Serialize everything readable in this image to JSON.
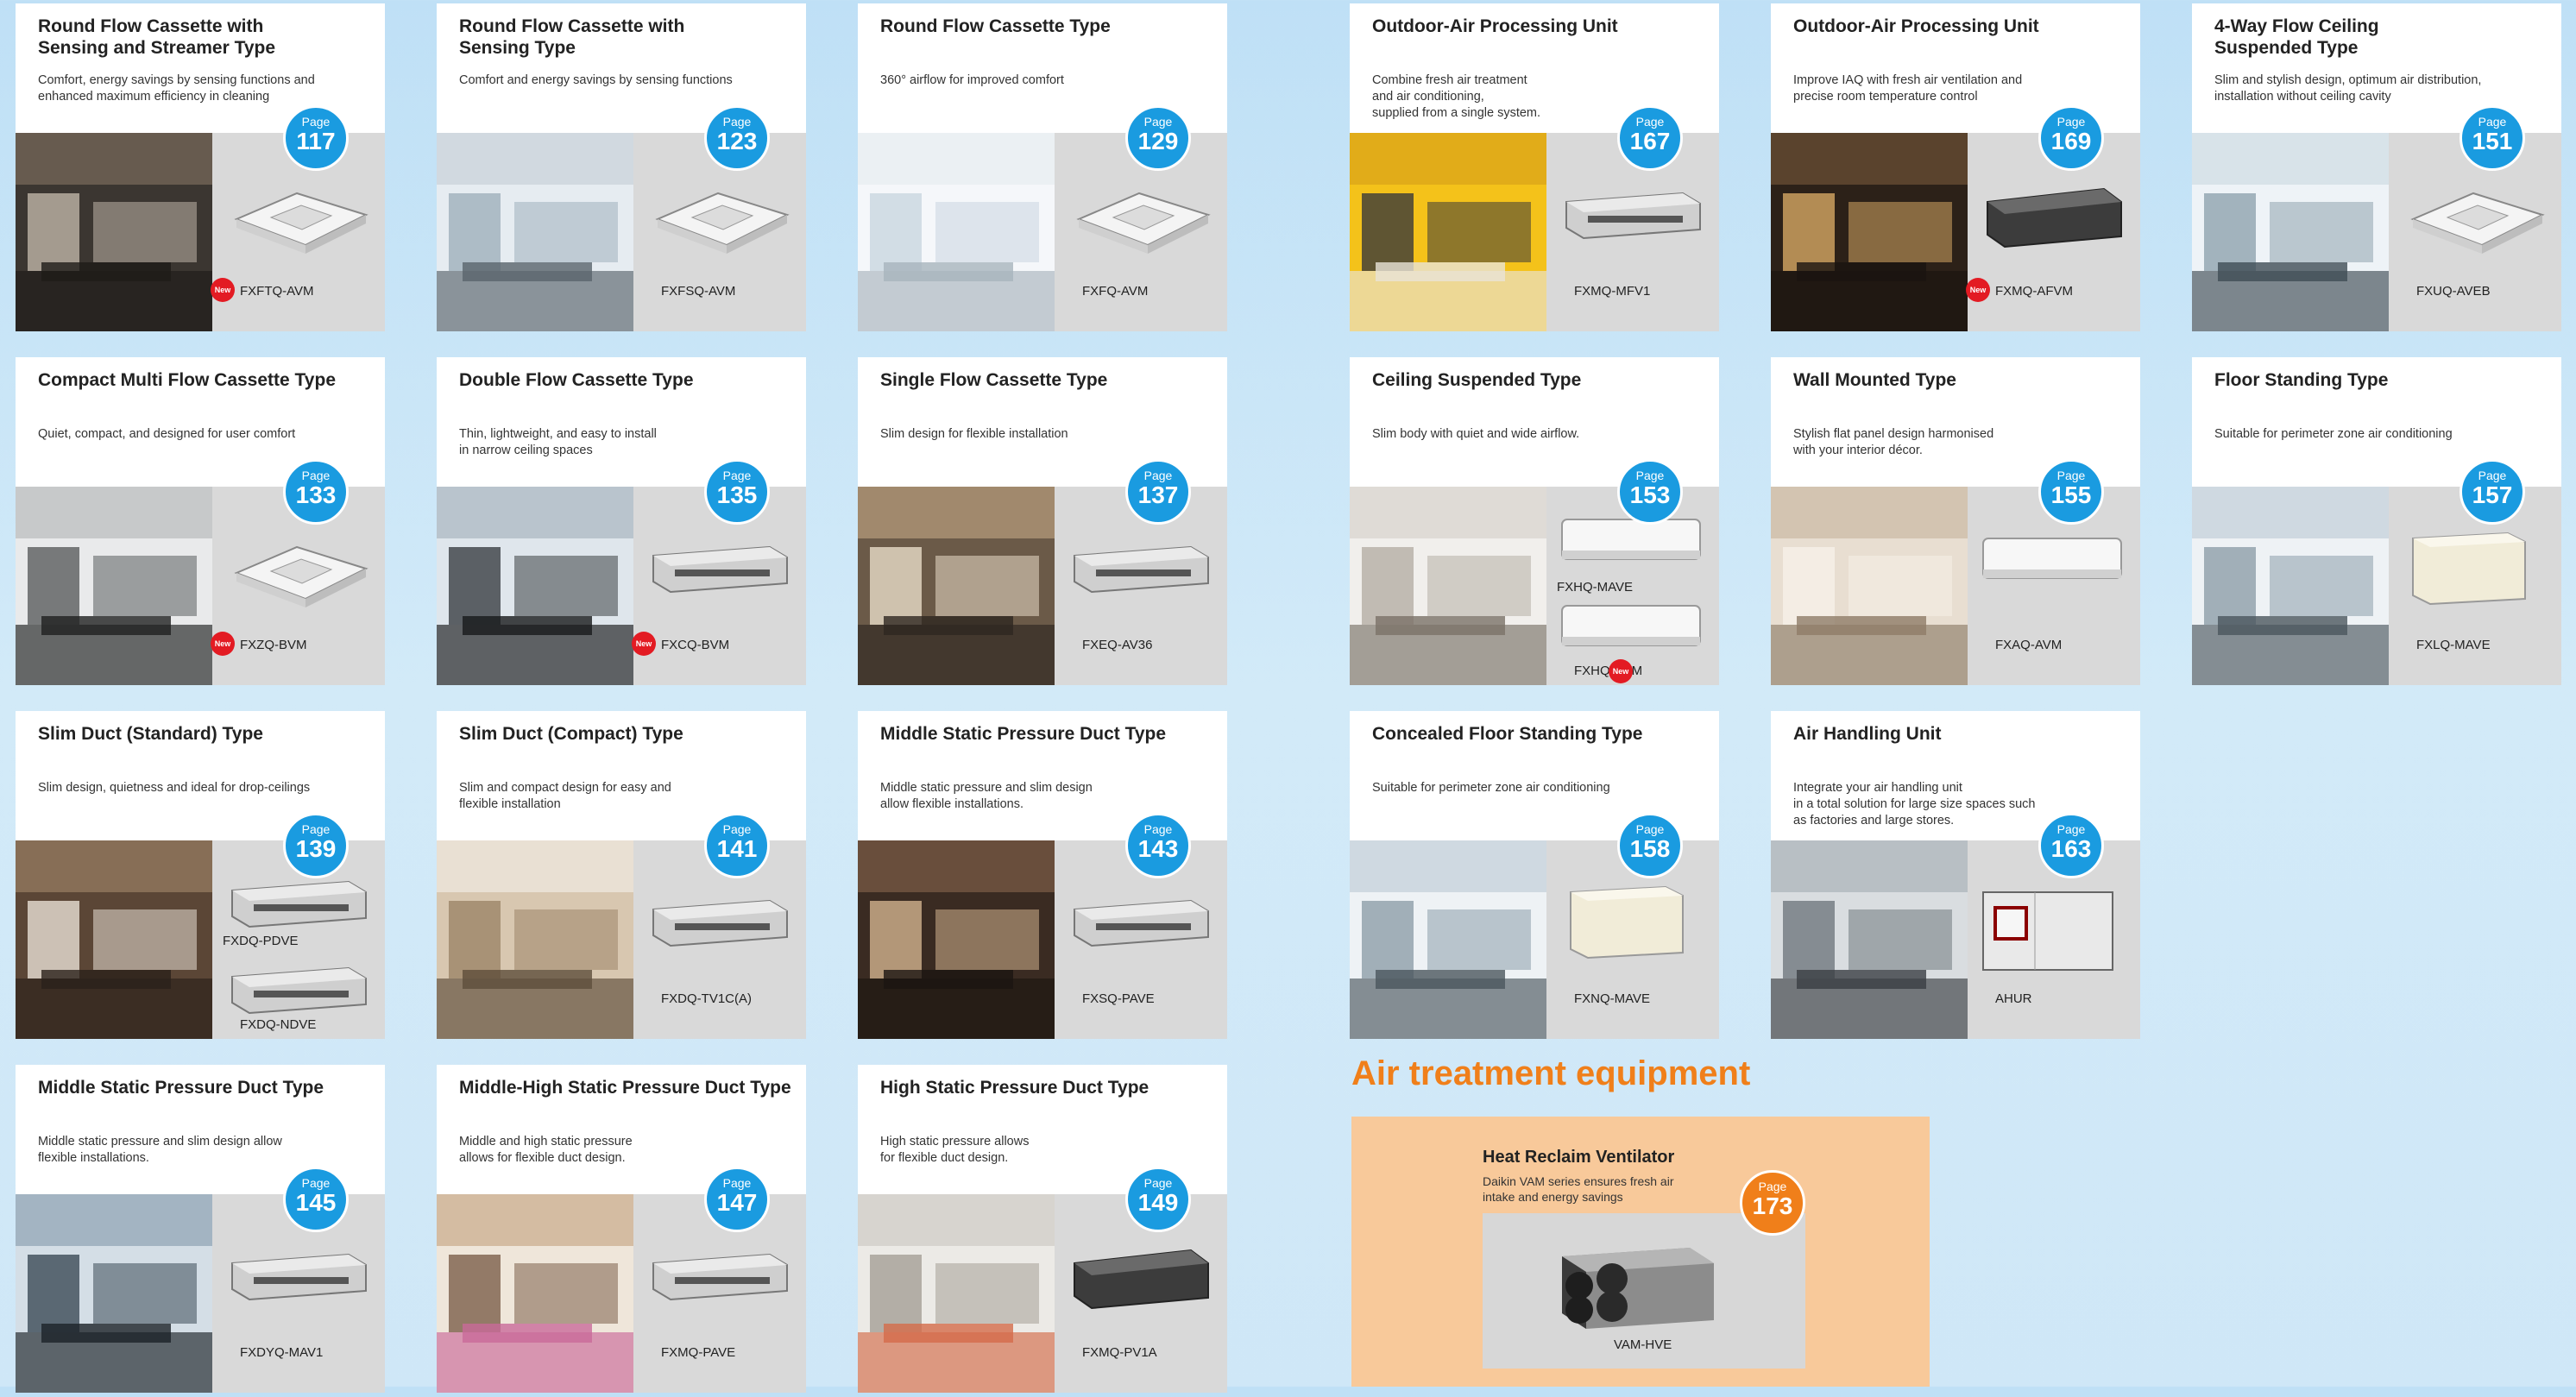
{
  "cards": [
    {
      "title": "Round Flow Cassette with\nSensing and Streamer Type",
      "desc": "Comfort, energy savings by sensing functions and\nenhanced maximum efficiency in cleaning",
      "page": "117",
      "model": "FXFTQ-AVM",
      "new": true,
      "photo": "restaurant"
    },
    {
      "title": "Round Flow Cassette with\nSensing Type",
      "desc": "Comfort and energy savings by sensing functions",
      "page": "123",
      "model": "FXFSQ-AVM",
      "new": false,
      "photo": "office"
    },
    {
      "title": "Round Flow Cassette Type",
      "desc": "360° airflow for improved comfort",
      "page": "129",
      "model": "FXFQ-AVM",
      "new": false,
      "photo": "bright-room"
    },
    {
      "title": "Outdoor-Air Processing Unit",
      "desc": "Combine fresh air treatment\nand air conditioning,\nsupplied from a single system.",
      "page": "167",
      "model": "FXMQ-MFV1",
      "new": false,
      "photo": "yellow-bar"
    },
    {
      "title": "Outdoor-Air Processing Unit",
      "desc": "Improve IAQ with fresh air ventilation and\nprecise room temperature control",
      "page": "169",
      "model": "FXMQ-AFVM",
      "new": true,
      "photo": "lobby"
    },
    {
      "title": "4-Way Flow Ceiling\nSuspended Type",
      "desc": "Slim and stylish design, optimum air distribution,\ninstallation without ceiling cavity",
      "page": "151",
      "model": "FXUQ-AVEB",
      "new": false,
      "photo": "lab"
    },
    {
      "title": "Compact Multi Flow Cassette Type",
      "desc": "Quiet, compact, and designed for user comfort",
      "page": "133",
      "model": "FXZQ-BVM",
      "new": true,
      "photo": "meeting"
    },
    {
      "title": "Double Flow Cassette Type",
      "desc": "Thin, lightweight, and easy to install\nin narrow ceiling spaces",
      "page": "135",
      "model": "FXCQ-BVM",
      "new": true,
      "photo": "boardroom"
    },
    {
      "title": "Single Flow Cassette Type",
      "desc": "Slim design for flexible installation",
      "page": "137",
      "model": "FXEQ-AV36",
      "new": false,
      "photo": "living"
    },
    {
      "title": "Ceiling Suspended Type",
      "desc": "Slim body with quiet and wide airflow.",
      "page": "153",
      "model": "FXHQ-MAVE",
      "model2": "FXHQ-BVM",
      "new": true,
      "photo": "reception"
    },
    {
      "title": "Wall Mounted Type",
      "desc": "Stylish flat panel design harmonised\nwith your interior décor.",
      "page": "155",
      "model": "FXAQ-AVM",
      "new": false,
      "photo": "lounge"
    },
    {
      "title": "Floor Standing Type",
      "desc": "Suitable for perimeter zone air conditioning",
      "page": "157",
      "model": "FXLQ-MAVE",
      "new": false,
      "photo": "window-office"
    },
    {
      "title": "Slim Duct (Standard) Type",
      "desc": "Slim design, quietness and ideal for drop-ceilings",
      "page": "139",
      "model": "FXDQ-PDVE",
      "model2": "FXDQ-NDVE",
      "new": false,
      "photo": "hotel-room"
    },
    {
      "title": "Slim Duct (Compact) Type",
      "desc": "Slim and compact design for easy and\nflexible installation",
      "page": "141",
      "model": "FXDQ-TV1C(A)",
      "new": false,
      "photo": "bedroom"
    },
    {
      "title": "Middle Static Pressure Duct Type",
      "desc": "Middle static pressure and slim design\nallow flexible installations.",
      "page": "143",
      "model": "FXSQ-PAVE",
      "new": false,
      "photo": "dining"
    },
    {
      "title": "Concealed Floor Standing Type",
      "desc": "Suitable for perimeter zone air conditioning",
      "page": "158",
      "model": "FXNQ-MAVE",
      "new": false,
      "photo": "window-office"
    },
    {
      "title": "Air Handling Unit",
      "desc": "Integrate your air handling unit\nin a total solution for large size spaces such\nas factories and large stores.",
      "page": "163",
      "model": "AHUR",
      "new": false,
      "photo": "mall"
    },
    {
      "title": "Middle Static Pressure Duct Type",
      "desc": "Middle static pressure and slim design allow\nflexible installations.",
      "page": "145",
      "model": "FXDYQ-MAV1",
      "new": false,
      "photo": "conference"
    },
    {
      "title": "Middle-High Static Pressure Duct Type",
      "desc": "Middle and high static pressure\nallows for flexible duct design.",
      "page": "147",
      "model": "FXMQ-PAVE",
      "new": false,
      "photo": "shop"
    },
    {
      "title": "High Static Pressure Duct Type",
      "desc": "High static pressure allows\nfor flexible duct design.",
      "page": "149",
      "model": "FXMQ-PV1A",
      "new": false,
      "photo": "gallery"
    }
  ],
  "page_label": "Page",
  "new_label": "New",
  "section_title": "Air treatment equipment",
  "hrv": {
    "title": "Heat Reclaim Ventilator",
    "desc": "Daikin VAM series ensures fresh air\nintake and energy savings",
    "page": "173",
    "model": "VAM-HVE"
  },
  "colors": {
    "badge_blue": "#1a9be0",
    "badge_orange": "#f07f1a",
    "new_red": "#e31b23",
    "panel_gray": "#d9d9d9"
  }
}
